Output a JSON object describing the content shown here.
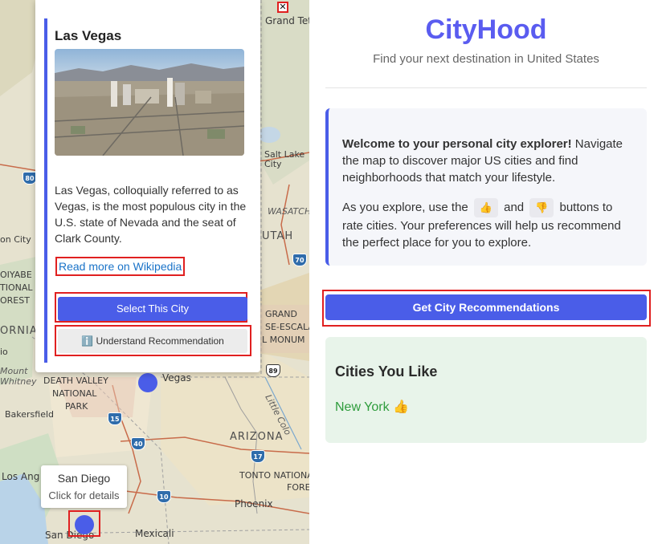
{
  "map": {
    "labels": {
      "grand_teton": "Grand Teton",
      "salt_lake_city": "Salt Lake City",
      "wasatch": "WASATCH",
      "utah": "UTAH",
      "grand": "GRAND",
      "staircase": "SE-ESCALANT",
      "monum": "L MONUM",
      "arizona": "ARIZONA",
      "tonto": "TONTO NATIONA",
      "fore": "FORE",
      "phoenix": "Phoenix",
      "mexicali": "Mexicali",
      "san_diego_map": "San Diego",
      "los_angeles": "Los Ang",
      "bakersfield": "Bakersfield",
      "death_valley": "DEATH VALLEY",
      "national": "NATIONAL",
      "park": "PARK",
      "vegas": "Vegas",
      "little_colorado": "Little Colo",
      "mount_whitney_1": "Mount",
      "mount_whitney_2": "Whitney",
      "ornia": "ORNIA",
      "on_city": "on City",
      "yabe": "OIYABE",
      "tional": "TIONAL",
      "orest": "OREST",
      "io": "io"
    },
    "shields": {
      "i80": "80",
      "i70": "70",
      "i15": "15",
      "i40": "40",
      "i10": "10",
      "us89": "89",
      "us17": "17"
    }
  },
  "popup": {
    "close_symbol": "✕",
    "title": "Las Vegas",
    "description": "Las Vegas, colloquially referred to as Vegas, is the most populous city in the U.S. state of Nevada and the seat of Clark County.",
    "wiki_link": "Read more on Wikipedia",
    "select_button": "Select This City",
    "understand_icon": "ℹ️",
    "understand_button": "Understand Recommendation"
  },
  "tooltip": {
    "title": "San Diego",
    "subtitle": "Click for details"
  },
  "sidebar": {
    "brand": "CityHood",
    "tagline": "Find your next destination in United States",
    "welcome": {
      "bold": "Welcome to your personal city explorer!",
      "text1": " Navigate the map to discover major US cities and find neighborhoods that match your lifestyle.",
      "text2a": "As you explore, use the ",
      "thumb_up": "👍",
      "text2b": " and ",
      "thumb_down": "👎",
      "text2c": " buttons to rate cities. Your preferences will help us recommend the perfect place for you to explore."
    },
    "recommend_button": "Get City Recommendations",
    "likes": {
      "title": "Cities You Like",
      "items": [
        {
          "name": "New York",
          "emoji": "👍"
        }
      ]
    }
  },
  "colors": {
    "accent": "#4a5de8",
    "brand": "#5a5cf0",
    "like_green": "#2e9c3c",
    "highlight_red": "#e02020"
  }
}
